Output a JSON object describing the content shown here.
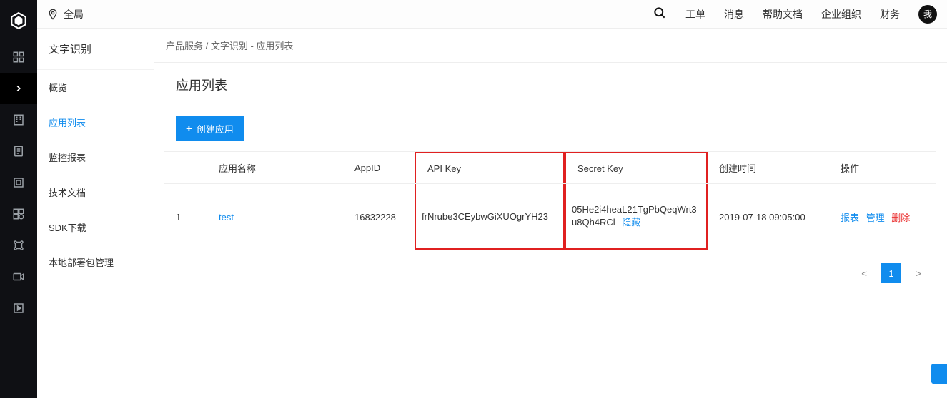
{
  "header": {
    "scope_label": "全局",
    "nav": {
      "ticket": "工单",
      "message": "消息",
      "help": "帮助文档",
      "org": "企业组织",
      "finance": "财务"
    },
    "avatar_text": "我"
  },
  "sidebar": {
    "title": "文字识别",
    "items": [
      {
        "label": "概览"
      },
      {
        "label": "应用列表"
      },
      {
        "label": "监控报表"
      },
      {
        "label": "技术文档"
      },
      {
        "label": "SDK下载"
      },
      {
        "label": "本地部署包管理"
      }
    ],
    "active_index": 1
  },
  "breadcrumb": "产品服务 / 文字识别 - 应用列表",
  "page_title": "应用列表",
  "create_button": "创建应用",
  "table": {
    "columns": {
      "idx": "",
      "name": "应用名称",
      "appid": "AppID",
      "apikey": "API Key",
      "secret": "Secret Key",
      "created": "创建时间",
      "ops": "操作"
    },
    "row": {
      "idx": "1",
      "name": "test",
      "appid": "16832228",
      "apikey": "frNrube3CEybwGiXUOgrYH23",
      "secret": "05He2i4heaL21TgPbQeqWrt3u8Qh4RCl",
      "secret_toggle": "隐藏",
      "created": "2019-07-18 09:05:00",
      "ops_report": "报表",
      "ops_manage": "管理",
      "ops_delete": "删除"
    }
  },
  "pager": {
    "prev": "<",
    "current": "1",
    "next": ">"
  }
}
